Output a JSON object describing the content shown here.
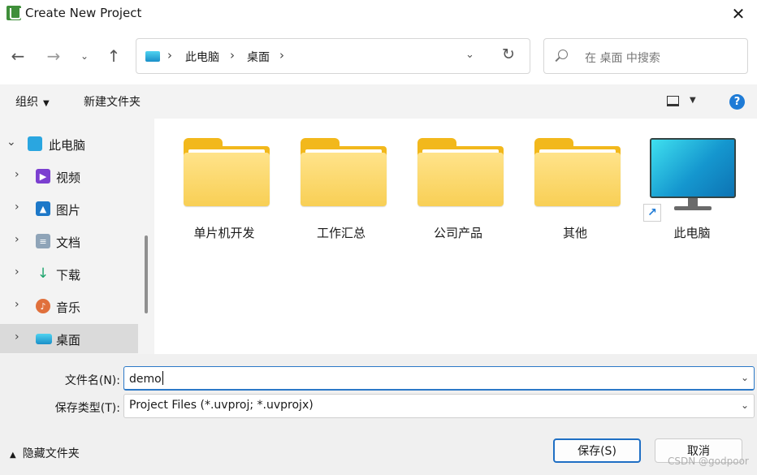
{
  "window": {
    "title": "Create New Project",
    "close_glyph": "✕"
  },
  "nav": {
    "back": "←",
    "forward": "→",
    "recent": "⌄",
    "up": "↑"
  },
  "address": {
    "crumbs": [
      "此电脑",
      "桌面"
    ],
    "dropdown": "⌄",
    "refresh": "↻"
  },
  "search": {
    "placeholder": "在 桌面 中搜索"
  },
  "commandbar": {
    "organize": "组织",
    "organize_caret": "▼",
    "new_folder": "新建文件夹",
    "view_caret": "▼",
    "help": "?"
  },
  "sidebar": {
    "items": [
      {
        "label": "此电脑",
        "chevron": "⌄",
        "icon": "pc-icon",
        "color": "#2aa6e0"
      },
      {
        "label": "视频",
        "chevron": "›",
        "icon": "video-icon",
        "color": "#7b3fd0"
      },
      {
        "label": "图片",
        "chevron": "›",
        "icon": "pictures-icon",
        "color": "#1d78c8"
      },
      {
        "label": "文档",
        "chevron": "›",
        "icon": "documents-icon",
        "color": "#8fa4b8"
      },
      {
        "label": "下载",
        "chevron": "›",
        "icon": "downloads-icon",
        "color": "#1aa36b"
      },
      {
        "label": "音乐",
        "chevron": "›",
        "icon": "music-icon",
        "color": "#e0703c"
      },
      {
        "label": "桌面",
        "chevron": "›",
        "icon": "desktop-icon",
        "color": "#2aa6e0",
        "selected": true
      }
    ]
  },
  "files": {
    "folders": [
      "单片机开发",
      "工作汇总",
      "公司产品",
      "其他"
    ],
    "this_pc": {
      "label": "此电脑",
      "shortcut_glyph": "↗"
    }
  },
  "form": {
    "filename_label": "文件名(N):",
    "filename_value": "demo",
    "filetype_label": "保存类型(T):",
    "filetype_value": "Project Files (*.uvproj; *.uvprojx)",
    "dropdown_glyph": "⌄"
  },
  "footer": {
    "hide_folders": "隐藏文件夹",
    "hide_caret": "▲",
    "save": "保存(S)",
    "cancel": "取消",
    "watermark": "CSDN @godpoor"
  }
}
